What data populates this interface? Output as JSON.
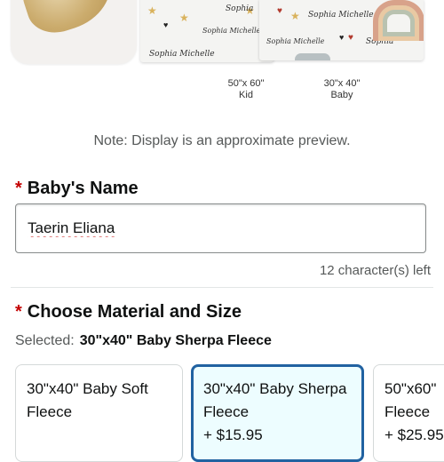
{
  "preview": {
    "thumbnails": [
      {
        "id": "kid",
        "names": [
          "Sophia",
          "Sophia Michelle",
          "Sophia Michelle"
        ],
        "size_line1": "50\"x 60\"",
        "size_line2": "Kid"
      },
      {
        "id": "baby",
        "names": [
          "Sophia Michelle",
          "Sophia Michelle",
          "Sophia"
        ],
        "size_line1": "30\"x 40\"",
        "size_line2": "Baby"
      }
    ]
  },
  "note": "Note: Display is an approximate preview.",
  "name_field": {
    "required_marker": "*",
    "label": "Baby's Name",
    "value": "Taerin Eliana",
    "chars_left": "12 character(s) left"
  },
  "material_field": {
    "required_marker": "*",
    "label": "Choose Material and Size",
    "selected_prefix": "Selected:",
    "selected_value": "30\"x40\" Baby Sherpa Fleece",
    "options": [
      {
        "label": "30\"x40\" Baby Soft Fleece",
        "price": "",
        "active": false
      },
      {
        "label": "30\"x40\" Baby Sherpa Fleece",
        "price": "+ $15.95",
        "active": true
      },
      {
        "label": "50\"x60\" Fleece",
        "price": "+ $25.95",
        "active": false
      }
    ]
  },
  "colors": {
    "accent_border": "#2162a1",
    "accent_bg": "#edfdff",
    "required": "#c40000"
  }
}
